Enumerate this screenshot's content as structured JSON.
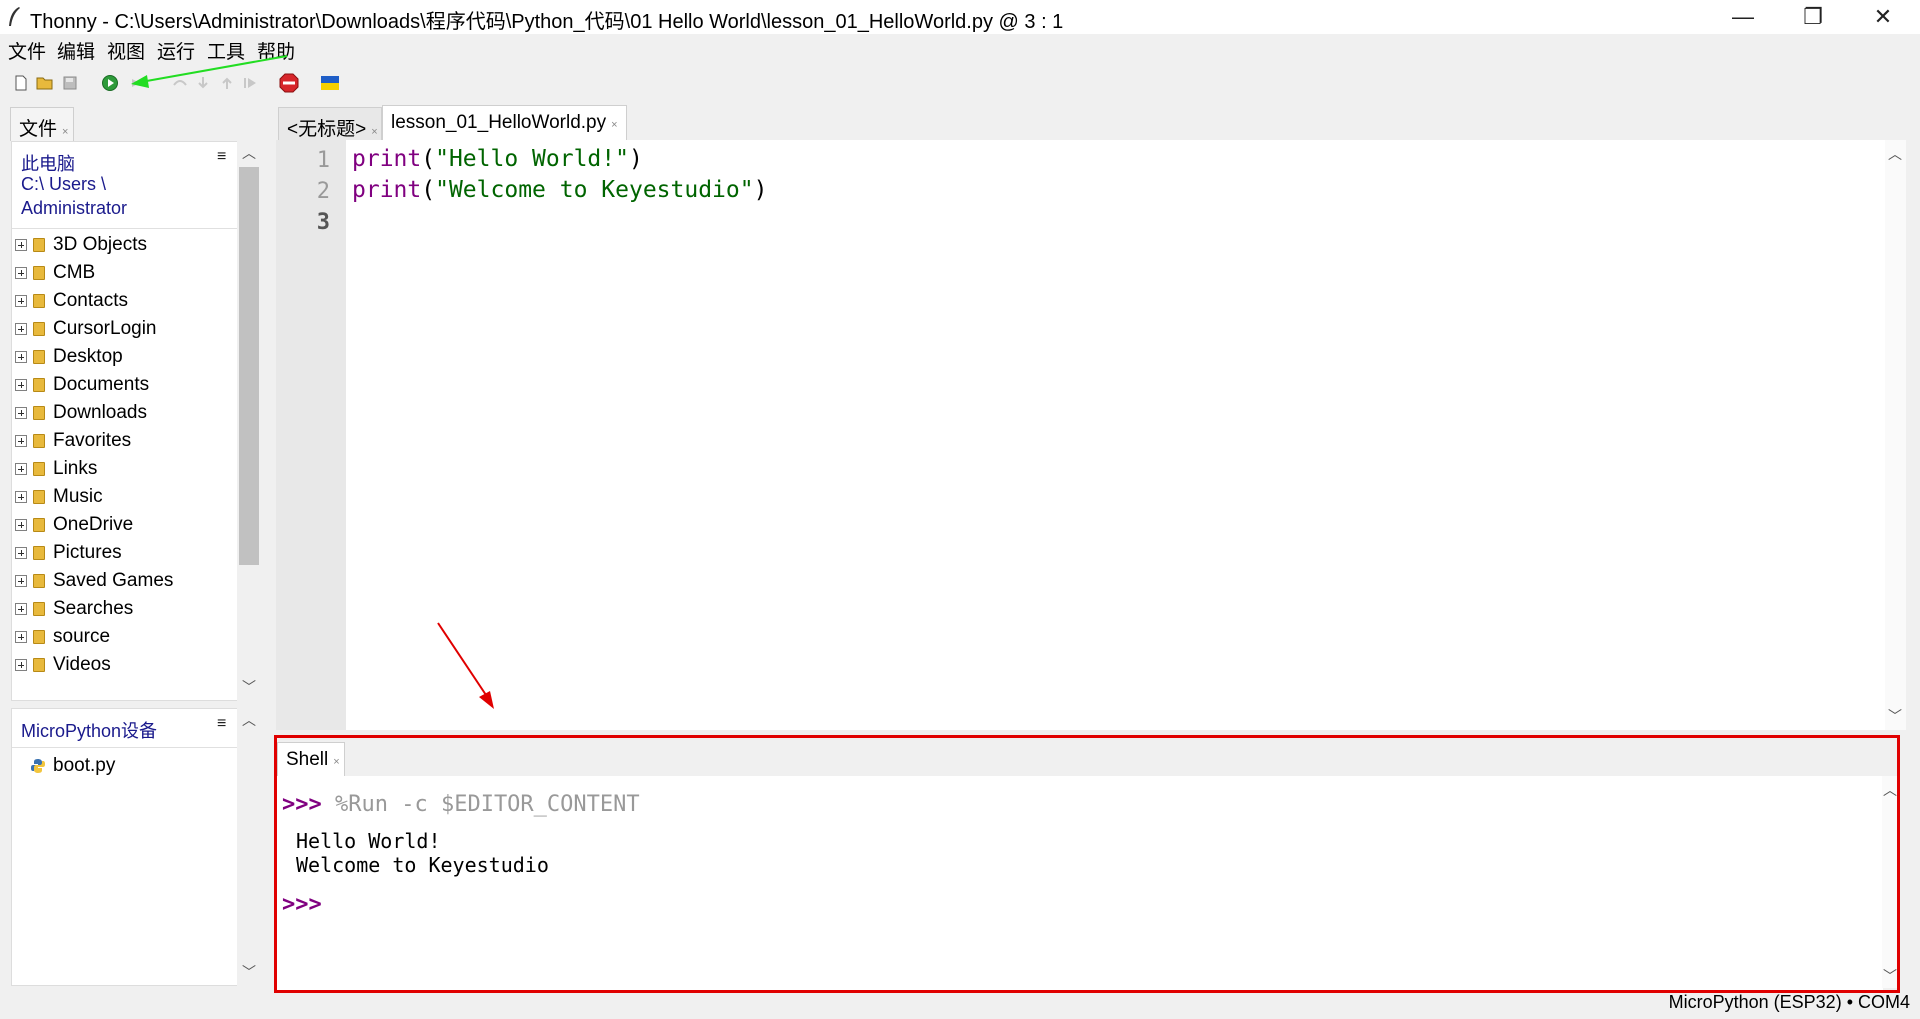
{
  "window": {
    "title": "Thonny  -  C:\\Users\\Administrator\\Downloads\\程序代码\\Python_代码\\01 Hello World\\lesson_01_HelloWorld.py  @  3 : 1",
    "minimize": "—",
    "maximize": "❐",
    "close": "✕"
  },
  "menu": [
    "文件",
    "编辑",
    "视图",
    "运行",
    "工具",
    "帮助"
  ],
  "toolbar": {
    "icons": [
      "new-file",
      "open-file",
      "save-file",
      "run",
      "debug",
      "step-over",
      "step-into",
      "step-out",
      "resume",
      "stop",
      "ukraine-flag"
    ]
  },
  "files_panel": {
    "tab": "文件",
    "path": [
      "此电脑",
      "C:\\ Users \\",
      "Administrator"
    ],
    "items": [
      "3D Objects",
      "CMB",
      "Contacts",
      "CursorLogin",
      "Desktop",
      "Documents",
      "Downloads",
      "Favorites",
      "Links",
      "Music",
      "OneDrive",
      "Pictures",
      "Saved Games",
      "Searches",
      "source",
      "Videos"
    ]
  },
  "device_panel": {
    "title": "MicroPython设备",
    "files": [
      "boot.py"
    ]
  },
  "editor": {
    "tabs": [
      "<无标题>",
      "lesson_01_HelloWorld.py"
    ],
    "active_tab": 1,
    "line_numbers": [
      "1",
      "2",
      "3"
    ],
    "lines": [
      {
        "fn": "print",
        "open": "(",
        "str": "\"Hello World!\"",
        "close": ")"
      },
      {
        "fn": "print",
        "open": "(",
        "str": "\"Welcome to Keyestudio\"",
        "close": ")"
      }
    ]
  },
  "shell": {
    "tab": "Shell",
    "prompt": ">>>",
    "command": "%Run -c $EDITOR_CONTENT",
    "output": [
      "Hello World!",
      "Welcome to Keyestudio"
    ]
  },
  "status": "MicroPython (ESP32)  •  COM4",
  "colors": {
    "highlight_red": "#e00000",
    "arrow_green": "#22dd22",
    "keyword_purple": "#800080",
    "string_green": "#006400"
  }
}
